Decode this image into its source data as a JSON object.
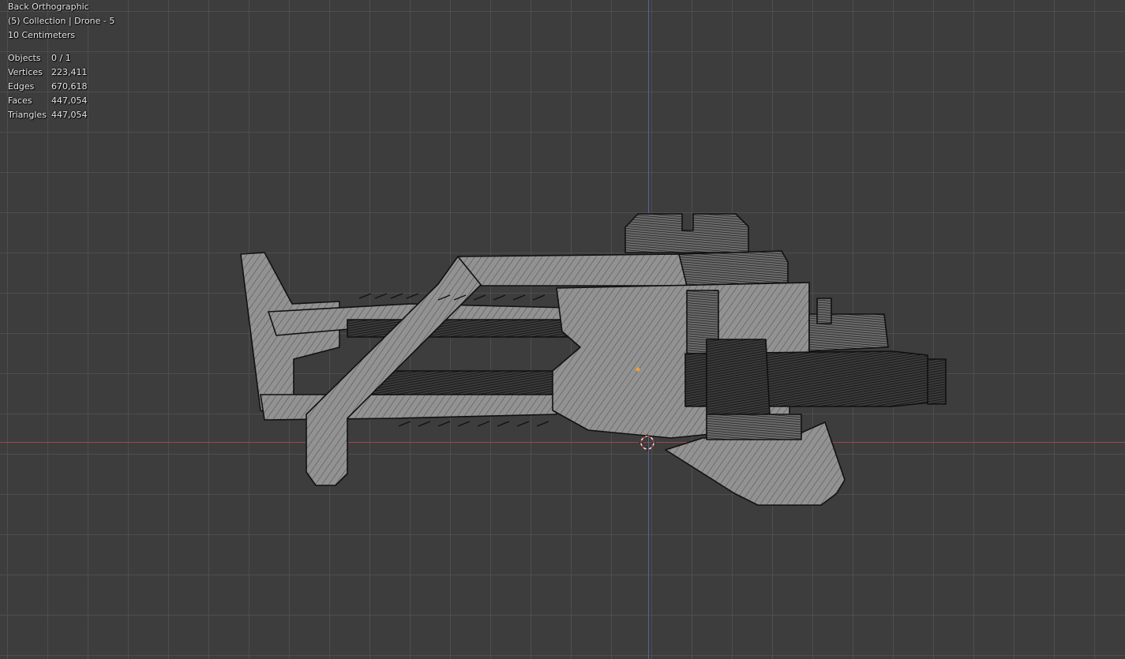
{
  "viewport": {
    "view_name": "Back Orthographic",
    "collection_line": "(5) Collection | Drone - 5",
    "grid_scale": "10 Centimeters",
    "stats": [
      {
        "label": "Objects",
        "value": "0 / 1"
      },
      {
        "label": "Vertices",
        "value": "223,411"
      },
      {
        "label": "Edges",
        "value": "670,618"
      },
      {
        "label": "Faces",
        "value": "447,054"
      },
      {
        "label": "Triangles",
        "value": "447,054"
      }
    ]
  },
  "colors": {
    "background": "#3d3d3d",
    "grid_line": "#505050",
    "x_axis": "#a84444",
    "y_axis": "#4a6a9e",
    "mesh_fill": "#8f8f8f",
    "mesh_wire": "#111111",
    "origin_dot": "#f0a030"
  }
}
